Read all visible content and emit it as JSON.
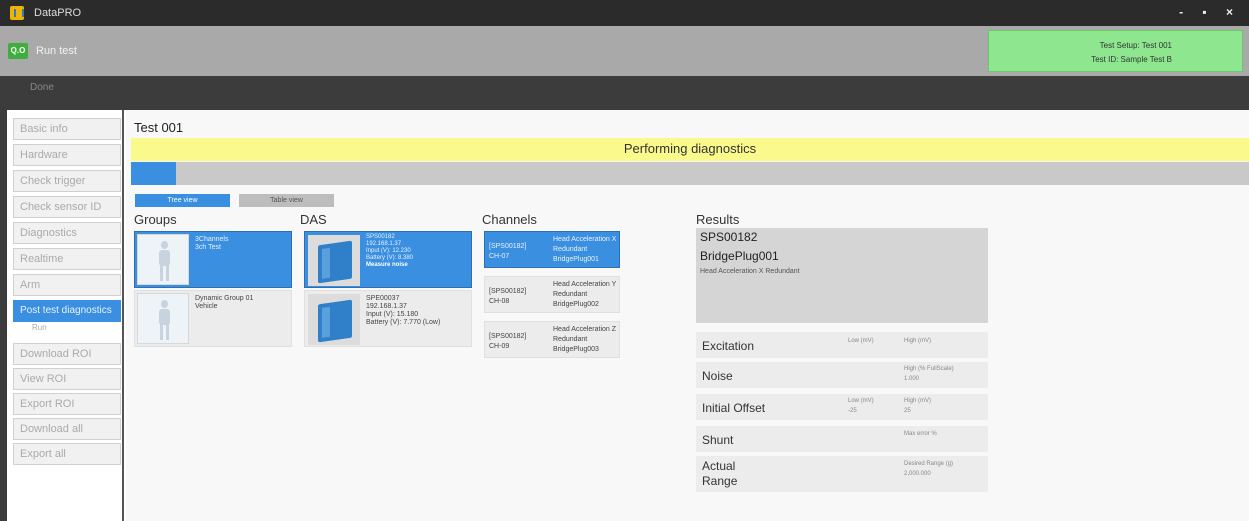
{
  "app": {
    "title": "DataPRO",
    "window_controls": "- ▪ ×"
  },
  "toolbar": {
    "run_icon_text": "Q.O",
    "run_label": "Run test"
  },
  "test_info": {
    "setup": "Test Setup: Test 001",
    "id": "Test ID: Sample Test B"
  },
  "subbar": {
    "done_label": "Done"
  },
  "sidebar": {
    "items": [
      {
        "label": "Basic info"
      },
      {
        "label": "Hardware"
      },
      {
        "label": "Check trigger"
      },
      {
        "label": "Check sensor ID"
      },
      {
        "label": "Diagnostics"
      },
      {
        "label": "Realtime"
      },
      {
        "label": "Arm"
      },
      {
        "label": "Post test diagnostics",
        "active": true
      },
      {
        "label": "Download ROI"
      },
      {
        "label": "View ROI"
      },
      {
        "label": "Export ROI"
      },
      {
        "label": "Download all"
      },
      {
        "label": "Export all"
      }
    ],
    "sub_item": "Run"
  },
  "main": {
    "test_title": "Test 001",
    "banner": "Performing diagnostics",
    "progress": 0.04,
    "view_buttons": {
      "tree": "Tree view",
      "table": "Table view"
    },
    "columns": {
      "groups": "Groups",
      "das": "DAS",
      "channels": "Channels",
      "results": "Results"
    }
  },
  "groups": [
    {
      "line1": "3Channels",
      "line2": "3ch Test",
      "selected": true
    },
    {
      "line1": "Dynamic Group 01",
      "line2": "Vehicle",
      "selected": false
    }
  ],
  "das": [
    {
      "serial": "SPS00182",
      "ip": "192.168.1.37",
      "input": "Input (V): 12.230",
      "battery": "Battery (V): 8.380",
      "status": "Measure noise",
      "selected": true
    },
    {
      "serial": "SPE00037",
      "ip": "192.168.1.37",
      "input": "Input (V): 15.180",
      "battery": "Battery (V): 7.770 (Low)",
      "status": "",
      "selected": false
    }
  ],
  "channels": [
    {
      "id": "[SPS00182]",
      "ch": "CH-07",
      "name": "Head Acceleration X",
      "type": "Redundant",
      "plug": "BridgePlug001",
      "selected": true
    },
    {
      "id": "[SPS00182]",
      "ch": "CH-08",
      "name": "Head Acceleration Y",
      "type": "Redundant",
      "plug": "BridgePlug002",
      "selected": false
    },
    {
      "id": "[SPS00182]",
      "ch": "CH-09",
      "name": "Head Acceleration Z",
      "type": "Redundant",
      "plug": "BridgePlug003",
      "selected": false
    }
  ],
  "results": {
    "line1": "SPS00182",
    "line2": "BridgePlug001",
    "description": "Head Acceleration X Redundant",
    "metrics": [
      {
        "name": "Excitation",
        "c1": "Low (mV)",
        "c1v": "",
        "c2": "High (mV)",
        "c2v": ""
      },
      {
        "name": "Noise",
        "c1": "",
        "c1v": "",
        "c2": "High (% FullScale)",
        "c2v": "1.000"
      },
      {
        "name": "Initial Offset",
        "c1": "Low (mV)",
        "c1v": "-25",
        "c2": "High (mV)",
        "c2v": "25"
      },
      {
        "name": "Shunt",
        "c1": "",
        "c1v": "",
        "c2": "Max error %",
        "c2v": ""
      },
      {
        "name": "Actual Range",
        "c1": "",
        "c1v": "",
        "c2": "Desired Range (g)",
        "c2v": "2,000.000"
      }
    ]
  },
  "colors": {
    "accent": "#3a8fe0",
    "banner": "#fafa8c",
    "test_info_bg": "#8ee68e",
    "run_icon": "#3fae3f"
  }
}
